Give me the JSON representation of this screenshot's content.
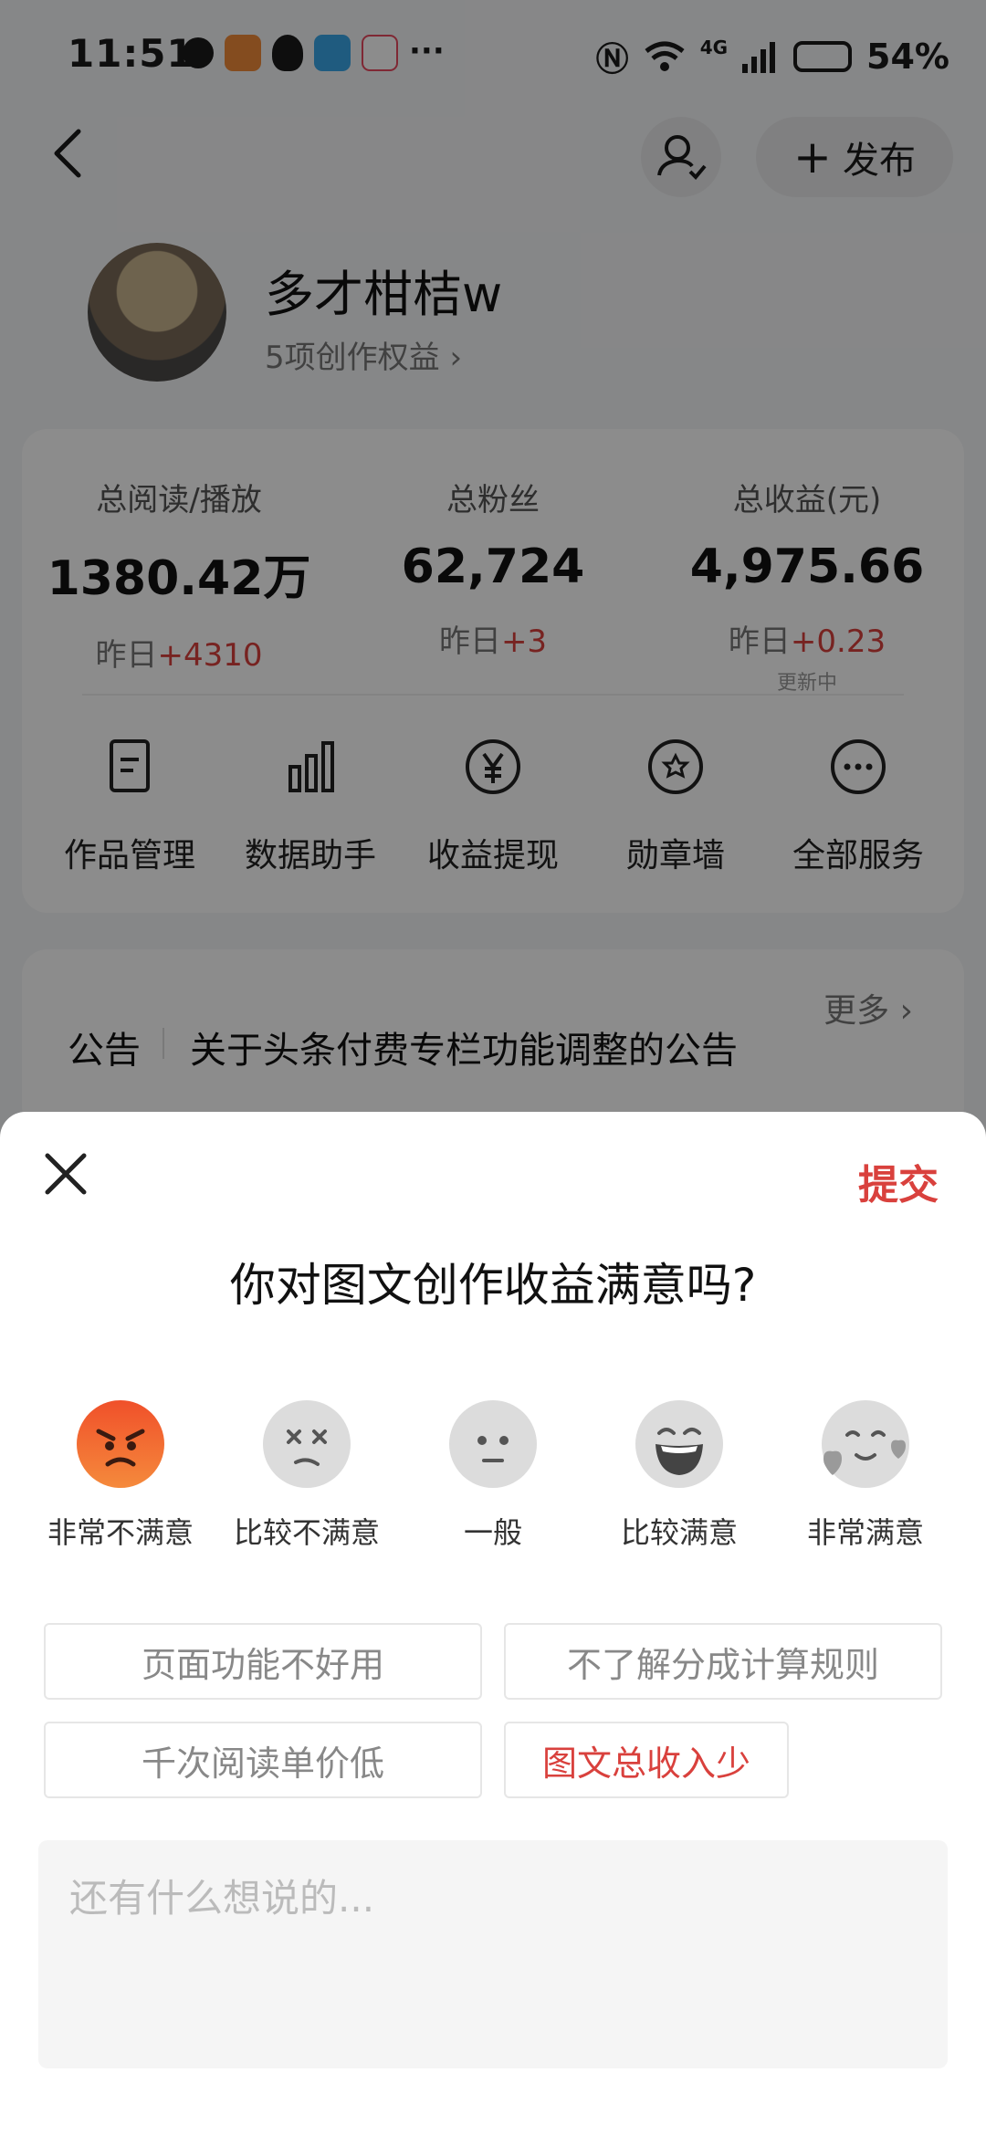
{
  "status_bar": {
    "time": "11:51",
    "dots": "···",
    "network": "4G",
    "battery": "54%"
  },
  "header": {
    "publish_label": "发布"
  },
  "profile": {
    "username": "多才柑桔w",
    "benefits": "5项创作权益 ›"
  },
  "stats": [
    {
      "label": "总阅读/播放",
      "value": "1380.42万",
      "delta_prefix": "昨日",
      "delta": "+4310",
      "note": ""
    },
    {
      "label": "总粉丝",
      "value": "62,724",
      "delta_prefix": "昨日",
      "delta": "+3",
      "note": ""
    },
    {
      "label": "总收益(元)",
      "value": "4,975.66",
      "delta_prefix": "昨日",
      "delta": "+0.23",
      "note": "更新中"
    }
  ],
  "services": [
    {
      "label": "作品管理",
      "icon": "document-icon"
    },
    {
      "label": "数据助手",
      "icon": "bar-chart-icon"
    },
    {
      "label": "收益提现",
      "icon": "yuan-icon"
    },
    {
      "label": "勋章墙",
      "icon": "badge-icon"
    },
    {
      "label": "全部服务",
      "icon": "more-icon"
    }
  ],
  "notice": {
    "title": "公告",
    "text": "关于头条付费专栏功能调整的公告",
    "more": "更多 ›"
  },
  "survey": {
    "submit_label": "提交",
    "question": "你对图文创作收益满意吗?",
    "ratings": [
      {
        "label": "非常不满意",
        "icon": "angry-face-icon",
        "color": "#f05a2a"
      },
      {
        "label": "比较不满意",
        "icon": "dizzy-face-icon",
        "color": "#d9d9d9"
      },
      {
        "label": "一般",
        "icon": "neutral-face-icon",
        "color": "#d9d9d9"
      },
      {
        "label": "比较满意",
        "icon": "laughing-face-icon",
        "color": "#d9d9d9"
      },
      {
        "label": "非常满意",
        "icon": "love-face-icon",
        "color": "#d9d9d9"
      }
    ],
    "reasons": [
      {
        "label": "页面功能不好用",
        "selected": false
      },
      {
        "label": "不了解分成计算规则",
        "selected": false
      },
      {
        "label": "千次阅读单价低",
        "selected": false
      },
      {
        "label": "图文总收入少",
        "selected": true
      }
    ],
    "comment_placeholder": "还有什么想说的..."
  },
  "colors": {
    "accent_red": "#d9413d",
    "overlay": "rgba(0,0,0,0.45)"
  }
}
